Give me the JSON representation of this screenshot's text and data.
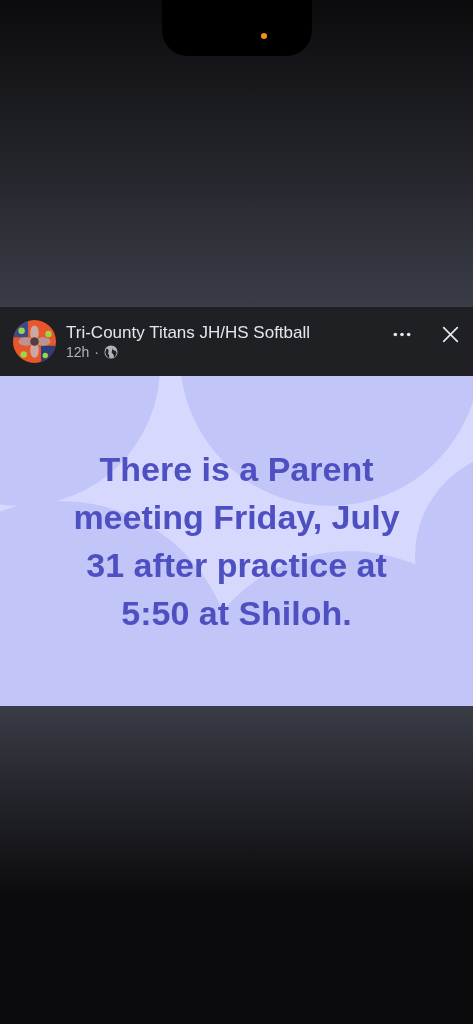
{
  "post": {
    "author": "Tri-County Titans JH/HS Softball",
    "time": "12h",
    "separator": "·",
    "message": "There is a Parent meeting Friday, July 31 after practice at 5:50 at Shiloh."
  }
}
